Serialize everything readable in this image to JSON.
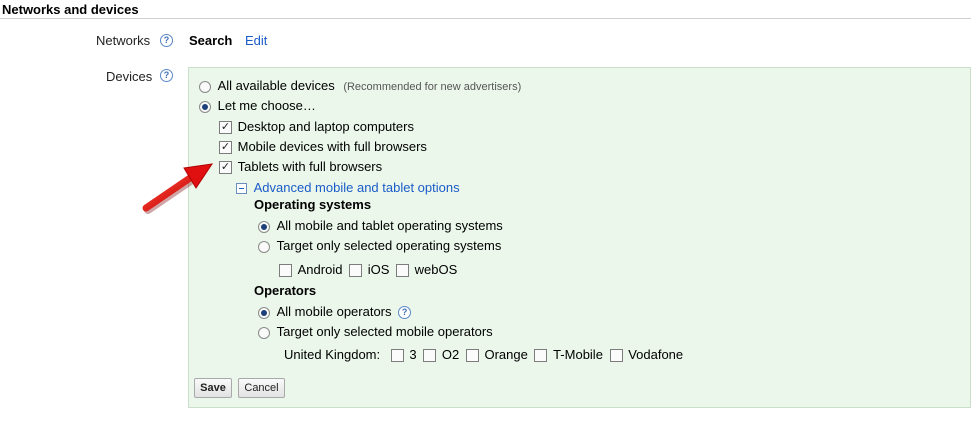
{
  "section": {
    "title": "Networks and devices"
  },
  "networks": {
    "label": "Networks",
    "value": "Search",
    "edit_label": "Edit",
    "help": "?"
  },
  "devices": {
    "label": "Devices",
    "help": "?",
    "options": {
      "all": {
        "label": "All available devices",
        "hint": "(Recommended for new advertisers)",
        "selected": false
      },
      "choose": {
        "label": "Let me choose…",
        "selected": true
      }
    },
    "device_types": [
      {
        "label": "Desktop and laptop computers",
        "checked": true
      },
      {
        "label": "Mobile devices with full browsers",
        "checked": true
      },
      {
        "label": "Tablets with full browsers",
        "checked": true
      }
    ],
    "advanced_link": "Advanced mobile and tablet options",
    "operating_systems": {
      "heading": "Operating systems",
      "options": [
        {
          "label": "All mobile and tablet operating systems",
          "selected": true
        },
        {
          "label": "Target only selected operating systems",
          "selected": false
        }
      ],
      "items": [
        {
          "label": "Android",
          "checked": false
        },
        {
          "label": "iOS",
          "checked": false
        },
        {
          "label": "webOS",
          "checked": false
        }
      ]
    },
    "operators": {
      "heading": "Operators",
      "help": "?",
      "options": [
        {
          "label": "All mobile operators",
          "selected": true
        },
        {
          "label": "Target only selected mobile operators",
          "selected": false
        }
      ],
      "country_label": "United Kingdom:",
      "items": [
        {
          "label": "3",
          "checked": false
        },
        {
          "label": "O2",
          "checked": false
        },
        {
          "label": "Orange",
          "checked": false
        },
        {
          "label": "T-Mobile",
          "checked": false
        },
        {
          "label": "Vodafone",
          "checked": false
        }
      ]
    }
  },
  "buttons": {
    "save": "Save",
    "cancel": "Cancel"
  },
  "check_mark": "✓",
  "colors": {
    "panel_bg": "#ebf7eb",
    "link": "#1a5cc8",
    "arrow": "#e01010"
  },
  "annotation": {
    "arrow_icon": "red-arrow-icon"
  }
}
